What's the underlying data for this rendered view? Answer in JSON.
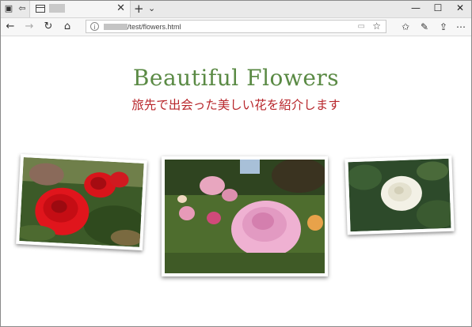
{
  "browser": {
    "tab": {
      "title": ""
    },
    "address": {
      "url": "/test/flowers.html"
    },
    "icons": [
      "tab-actions-icon",
      "set-aside-tabs-icon",
      "page-icon",
      "close-icon",
      "new-tab-icon",
      "tab-list-icon",
      "minimize-icon",
      "maximize-icon",
      "window-close-icon",
      "back-icon",
      "forward-icon",
      "refresh-icon",
      "home-icon",
      "info-icon",
      "reading-view-icon",
      "favorite-star-icon",
      "favorites-hub-icon",
      "add-notes-icon",
      "share-icon",
      "more-icon"
    ]
  },
  "page": {
    "title": "Beautiful Flowers",
    "subtitle": "旅先で出会った美しい花を紹介します",
    "colors": {
      "title": "#5a8a44",
      "subtitle": "#b8272c"
    },
    "photos": [
      {
        "name": "red-rose-photo",
        "subject": "red rose"
      },
      {
        "name": "pink-rose-photo",
        "subject": "pink rose"
      },
      {
        "name": "white-rose-photo",
        "subject": "white rose"
      }
    ]
  }
}
